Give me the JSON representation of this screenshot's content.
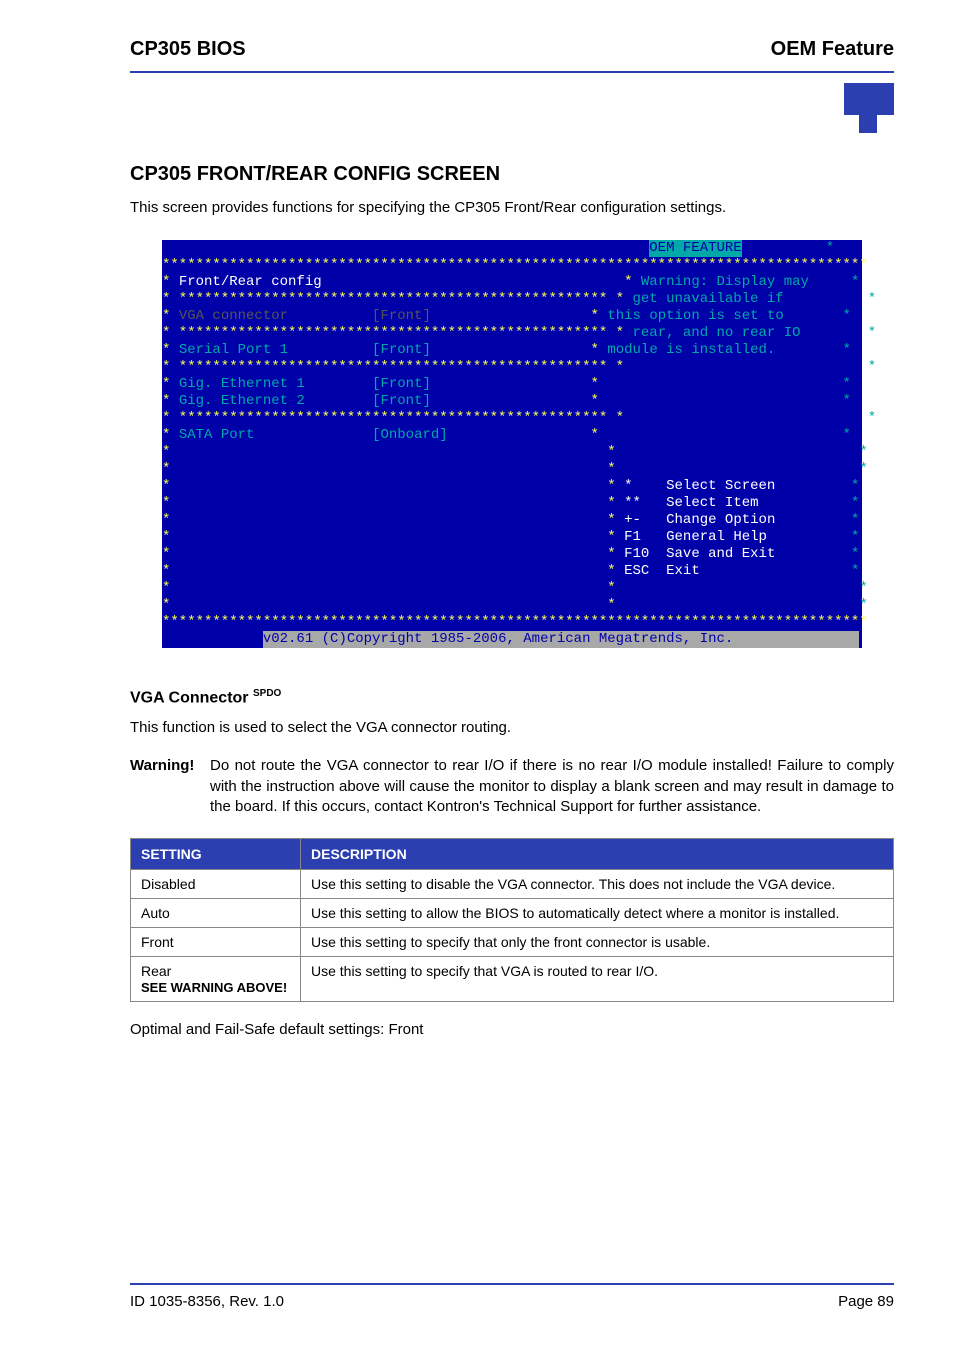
{
  "header": {
    "left": "CP305 BIOS",
    "right": "OEM Feature"
  },
  "section": {
    "title": "CP305 FRONT/REAR CONFIG SCREEN",
    "intro": "This screen provides functions for specifying the CP305 Front/Rear configuration settings."
  },
  "bios": {
    "title_label": "OEM FEATURE",
    "section_label": "Front/Rear config",
    "items": {
      "vga": {
        "label": "VGA connector",
        "value": "[Front]"
      },
      "serial": {
        "label": "Serial Port 1",
        "value": "[Front]"
      },
      "ge1": {
        "label": "Gig. Ethernet 1",
        "value": "[Front]"
      },
      "ge2": {
        "label": "Gig. Ethernet 2",
        "value": "[Front]"
      },
      "sata": {
        "label": "SATA Port",
        "value": "[Onboard]"
      }
    },
    "help_text": {
      "l1": "Warning: Display may",
      "l2": "get unavailable if",
      "l3": "this option is set to",
      "l4": "rear, and no rear IO",
      "l5": "module is installed."
    },
    "keys": {
      "select_screen": {
        "key": "*",
        "label": "Select Screen"
      },
      "select_item": {
        "key": "**",
        "label": "Select Item"
      },
      "change_option": {
        "key": "+-",
        "label": "Change Option"
      },
      "general_help": {
        "key": "F1",
        "label": "General Help"
      },
      "save_exit": {
        "key": "F10",
        "label": "Save and Exit"
      },
      "exit": {
        "key": "ESC",
        "label": "Exit"
      }
    },
    "copyright": "v02.61 (C)Copyright 1985-2006, American Megatrends, Inc."
  },
  "vga_section": {
    "heading": "VGA Connector",
    "sup": "SPDO",
    "body": "This function is used to select the VGA connector routing.",
    "warning_label": "Warning!",
    "warning_text": "Do not route the VGA connector to rear I/O if there is no rear I/O module installed! Failure to comply with the instruction above will cause the monitor to display a blank screen and may result in damage to the board. If this occurs, contact Kontron's Technical Support for further assistance."
  },
  "table": {
    "headers": {
      "setting": "SETTING",
      "description": "DESCRIPTION"
    },
    "rows": [
      {
        "setting": "Disabled",
        "sub": "",
        "description": "Use this setting to disable the VGA connector. This does not include the VGA device."
      },
      {
        "setting": "Auto",
        "sub": "",
        "description": "Use this setting to allow the BIOS to automatically detect where a monitor is installed."
      },
      {
        "setting": "Front",
        "sub": "",
        "description": "Use this setting to specify that only the front connector is usable."
      },
      {
        "setting": "Rear",
        "sub": "SEE WARNING ABOVE!",
        "description": "Use this setting to specify that VGA is routed to rear I/O."
      }
    ]
  },
  "defaults_line": "Optimal and Fail-Safe default settings: Front",
  "footer": {
    "left": "ID 1035-8356, Rev. 1.0",
    "right": "Page 89"
  }
}
